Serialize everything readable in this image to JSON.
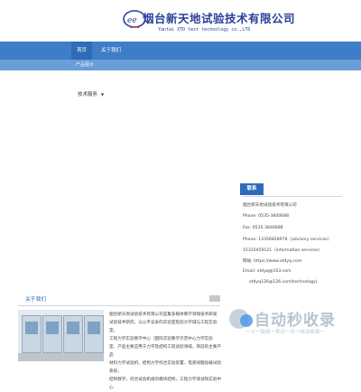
{
  "header": {
    "company_name": "烟台新天地试验技术有限公司",
    "company_name_en": "Yantai XTD test technology co.,LTD",
    "logo_text": "新天地"
  },
  "nav": {
    "items": [
      {
        "label": "首页"
      },
      {
        "label": "关于我们"
      }
    ],
    "sub_item": "产品展示"
  },
  "left_menu": {
    "label": "技术服务"
  },
  "contact": {
    "title": "联系",
    "company": "烟台新天地试验技术有限公司",
    "phone": "Phone: 0535-3840688",
    "fax": "Fax: 0535-3840688",
    "phone2": "Phone: 13356828978（advisory services）",
    "phone3": "15315459121（information services）",
    "web": "网站: https://www.xtdyq.com",
    "email": "Email: xtdyq@163.com",
    "email2": "xtdyq126@126.com(technology)"
  },
  "about": {
    "title": "关于我们",
    "lines": [
      "烟台新天地试验技术有限公司是集多媒体教学领域技术研发",
      "试验技术研究，以公平竞争的实验室检验大学城与工程实验室，",
      "工程力学实验教学中心（国际实验教学示范中心力学实验",
      "室、产品主要应用于力学及结构工程试验领域，目前的主要产品",
      "材料力学试验机、结构力学综合实验装置、电液伺服加载试验系统，",
      "结构教学，综合试验机组的模块结构，工程力学测试和实验中心"
    ]
  },
  "watermark": {
    "text": "自动秒收录",
    "sub": "一上一链接一来访一次一自动收录一"
  },
  "colors": {
    "nav": "#3f7dc9",
    "nav_active": "#2e6bb8",
    "brand": "#2a3f9a",
    "logo_accent": "#d23a2a"
  }
}
